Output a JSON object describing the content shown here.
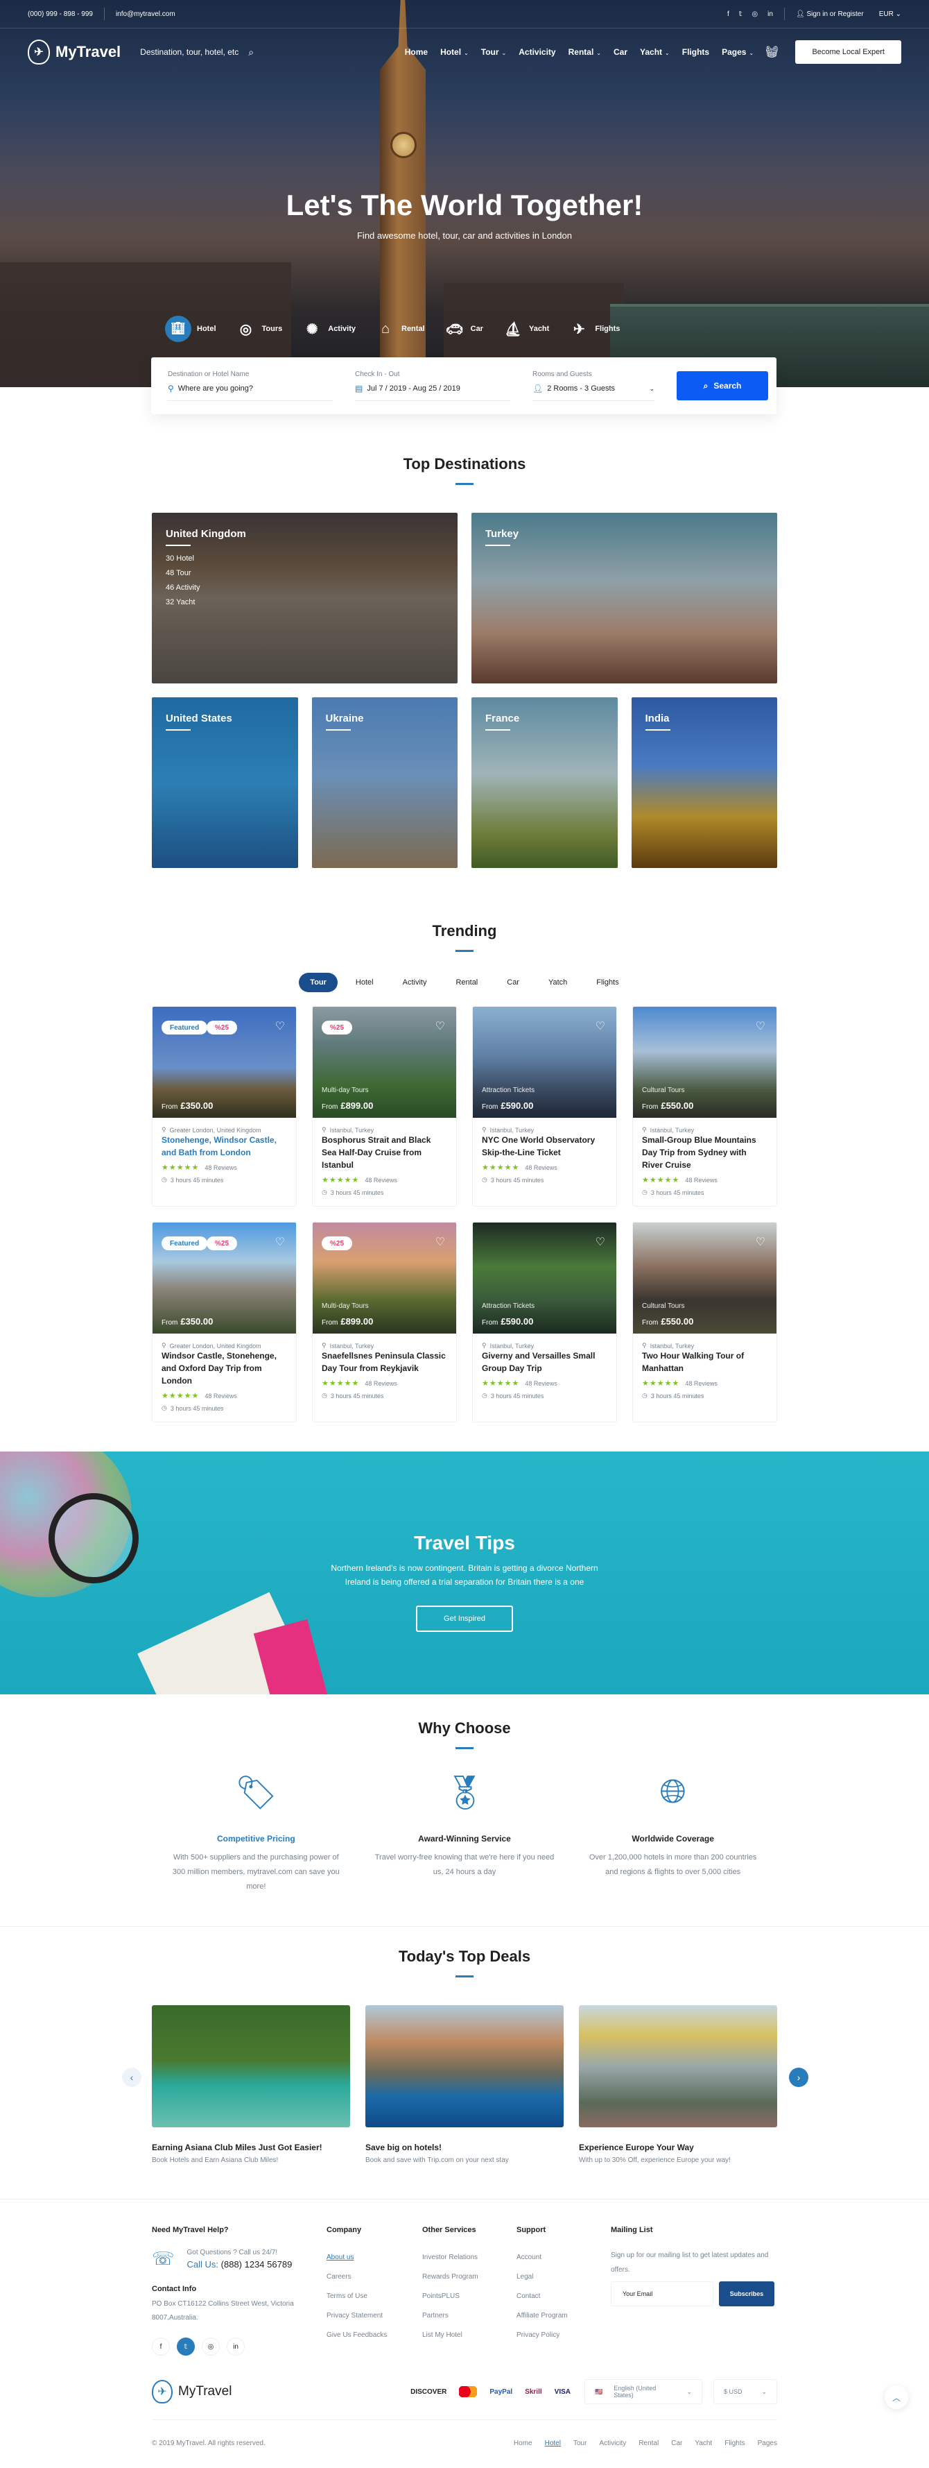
{
  "topbar": {
    "phone": "(000) 999 - 898 - 999",
    "email": "info@mytravel.com",
    "social": [
      "facebook-icon",
      "twitter-icon",
      "instagram-icon",
      "linkedin-icon"
    ],
    "signin": "Sign in or Register",
    "currency": "EUR"
  },
  "nav": {
    "brand": "MyTravel",
    "search_placeholder": "Destination, tour, hotel, etc",
    "items": [
      {
        "label": "Home",
        "dropdown": false
      },
      {
        "label": "Hotel",
        "dropdown": true
      },
      {
        "label": "Tour",
        "dropdown": true
      },
      {
        "label": "Activicity",
        "dropdown": false
      },
      {
        "label": "Rental",
        "dropdown": true
      },
      {
        "label": "Car",
        "dropdown": false
      },
      {
        "label": "Yacht",
        "dropdown": true
      },
      {
        "label": "Flights",
        "dropdown": false
      },
      {
        "label": "Pages",
        "dropdown": true
      }
    ],
    "cta": "Become Local Expert"
  },
  "hero": {
    "title": "Let's The World Together!",
    "subtitle": "Find awesome hotel, tour, car and activities in London",
    "tabs": [
      {
        "label": "Hotel",
        "icon": "hotel-icon",
        "active": true
      },
      {
        "label": "Tours",
        "icon": "tours-icon",
        "active": false
      },
      {
        "label": "Activity",
        "icon": "activity-icon",
        "active": false
      },
      {
        "label": "Rental",
        "icon": "rental-icon",
        "active": false
      },
      {
        "label": "Car",
        "icon": "car-icon",
        "active": false
      },
      {
        "label": "Yacht",
        "icon": "yacht-icon",
        "active": false
      },
      {
        "label": "Flights",
        "icon": "flights-icon",
        "active": false
      }
    ]
  },
  "search": {
    "destination_label": "Destination or Hotel Name",
    "destination_placeholder": "Where are you going?",
    "dates_label": "Check In - Out",
    "dates_value": "Jul 7 / 2019 - Aug 25 / 2019",
    "guests_label": "Rooms and Guests",
    "guests_value": "2 Rooms - 3 Guests",
    "button": "Search"
  },
  "destinations": {
    "title": "Top Destinations",
    "items": [
      {
        "name": "United Kingdom",
        "stats": [
          "30 Hotel",
          "48 Tour",
          "46 Activity",
          "32 Yacht"
        ]
      },
      {
        "name": "Turkey",
        "stats": []
      },
      {
        "name": "United States",
        "stats": []
      },
      {
        "name": "Ukraine",
        "stats": []
      },
      {
        "name": "France",
        "stats": []
      },
      {
        "name": "India",
        "stats": []
      }
    ]
  },
  "trending": {
    "title": "Trending",
    "tabs": [
      "Tour",
      "Hotel",
      "Activity",
      "Rental",
      "Car",
      "Yatch",
      "Flights"
    ],
    "active_tab": "Tour",
    "cards": [
      {
        "featured": "Featured",
        "discount": "%25",
        "category": "",
        "from": "From",
        "price": "£350.00",
        "location": "Greater London, United Kingdom",
        "title": "Stonehenge, Windsor Castle, and Bath from London",
        "highlight": true,
        "rating": 5,
        "reviews": "48 Reviews",
        "duration": "3 hours 45 minutes"
      },
      {
        "featured": "",
        "discount": "%25",
        "category": "Multi-day Tours",
        "from": "From",
        "price": "£899.00",
        "location": "Istanbul, Turkey",
        "title": "Bosphorus Strait and Black Sea Half-Day Cruise from Istanbul",
        "highlight": false,
        "rating": 5,
        "reviews": "48 Reviews",
        "duration": "3 hours 45 minutes"
      },
      {
        "featured": "",
        "discount": "",
        "category": "Attraction Tickets",
        "from": "From",
        "price": "£590.00",
        "location": "Istanbul, Turkey",
        "title": "NYC One World Observatory Skip-the-Line Ticket",
        "highlight": false,
        "rating": 5,
        "reviews": "48 Reviews",
        "duration": "3 hours 45 minutes"
      },
      {
        "featured": "",
        "discount": "",
        "category": "Cultural Tours",
        "from": "From",
        "price": "£550.00",
        "location": "Istanbul, Turkey",
        "title": "Small-Group Blue Mountains Day Trip from Sydney with River Cruise",
        "highlight": false,
        "rating": 5,
        "reviews": "48 Reviews",
        "duration": "3 hours 45 minutes"
      },
      {
        "featured": "Featured",
        "discount": "%25",
        "category": "",
        "from": "From",
        "price": "£350.00",
        "location": "Greater London, United Kingdom",
        "title": "Windsor Castle, Stonehenge, and Oxford Day Trip from London",
        "highlight": false,
        "rating": 5,
        "reviews": "48 Reviews",
        "duration": "3 hours 45 minutes"
      },
      {
        "featured": "",
        "discount": "%25",
        "category": "Multi-day Tours",
        "from": "From",
        "price": "£899.00",
        "location": "Istanbul, Turkey",
        "title": "Snaefellsnes Peninsula Classic Day Tour from Reykjavik",
        "highlight": false,
        "rating": 5,
        "reviews": "48 Reviews",
        "duration": "3 hours 45 minutes"
      },
      {
        "featured": "",
        "discount": "",
        "category": "Attraction Tickets",
        "from": "From",
        "price": "£590.00",
        "location": "Istanbul, Turkey",
        "title": "Giverny and Versailles Small Group Day Trip",
        "highlight": false,
        "rating": 5,
        "reviews": "48 Reviews",
        "duration": "3 hours 45 minutes"
      },
      {
        "featured": "",
        "discount": "",
        "category": "Cultural Tours",
        "from": "From",
        "price": "£550.00",
        "location": "Istanbul, Turkey",
        "title": "Two Hour Walking Tour of Manhattan",
        "highlight": false,
        "rating": 5,
        "reviews": "48 Reviews",
        "duration": "3 hours 45 minutes"
      }
    ]
  },
  "tips": {
    "title": "Travel Tips",
    "text": "Northern Ireland’s is now contingent. Britain is getting a divorce Northern Ireland is being offered a trial separation for Britain there is a one",
    "button": "Get Inspired"
  },
  "why": {
    "title": "Why Choose",
    "items": [
      {
        "icon": "price-tag-icon",
        "title": "Competitive Pricing",
        "text": "With 500+ suppliers and the purchasing power of 300 million members, mytravel.com can save you more!",
        "highlight": true
      },
      {
        "icon": "award-icon",
        "title": "Award-Winning Service",
        "text": "Travel worry-free knowing that we're here if you need us, 24 hours a day",
        "highlight": false
      },
      {
        "icon": "globe-icon",
        "title": "Worldwide Coverage",
        "text": "Over 1,200,000 hotels in more than 200 countries and regions & flights to over 5,000 cities",
        "highlight": false
      }
    ]
  },
  "deals": {
    "title": "Today's Top Deals",
    "items": [
      {
        "title": "Earning Asiana Club Miles Just Got Easier!",
        "text": "Book Hotels and Earn Asiana Club Miles!"
      },
      {
        "title": "Save big on hotels!",
        "text": "Book and save with Trip.com on your next stay"
      },
      {
        "title": "Experience Europe Your Way",
        "text": "With up to 30% Off, experience Europe your way!"
      }
    ]
  },
  "footer": {
    "help_title": "Need MyTravel Help?",
    "help_question": "Got Questions ? Call us 24/7!",
    "call_label": "Call Us:",
    "call_number": "(888) 1234 56789",
    "contact_title": "Contact Info",
    "address": "PO Box CT16122 Collins Street West, Victoria 8007,Australia.",
    "columns": [
      {
        "title": "Company",
        "links": [
          "About us",
          "Careers",
          "Terms of Use",
          "Privacy Statement",
          "Give Us Feedbacks"
        ]
      },
      {
        "title": "Other Services",
        "links": [
          "Investor Relations",
          "Rewards Program",
          "PointsPLUS",
          "Partners",
          "List My Hotel"
        ]
      },
      {
        "title": "Support",
        "links": [
          "Account",
          "Legal",
          "Contact",
          "Affiliate Program",
          "Privacy Policy"
        ]
      }
    ],
    "mailing_title": "Mailing List",
    "mailing_text": "Sign up for our mailing list to get latest updates and offers.",
    "email_placeholder": "Your Email",
    "subscribe": "Subscribes",
    "brand": "MyTravel",
    "payments": [
      "DISCOVER",
      "MasterCard",
      "PayPal",
      "Skrill",
      "VISA"
    ],
    "language": "English (United States)",
    "currency": "$ USD",
    "copyright": "© 2019 MyTravel. All rights reserved.",
    "bottom_links": [
      "Home",
      "Hotel",
      "Tour",
      "Activicity",
      "Rental",
      "Car",
      "Yacht",
      "Flights",
      "Pages"
    ],
    "bottom_active": "Hotel"
  },
  "colors": {
    "primary": "#297cbb",
    "search_button": "#0a5cf5",
    "dark_blue": "#1a4d8c",
    "discount": "#f0386b",
    "stars": "#7ec41c",
    "tips_bg": "#1ba7bd"
  }
}
